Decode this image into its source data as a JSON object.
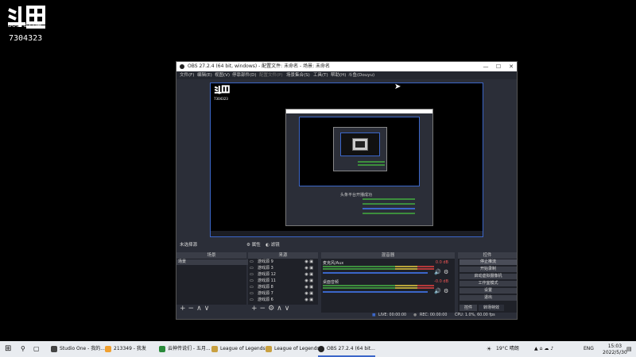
{
  "watermark": {
    "domain": "DOUYU.COM",
    "room_id": "7304323"
  },
  "obs": {
    "title": "OBS 27.2.4 (64 bit, windows) - 配置文件: 未命名 - 场景: 未命名",
    "window_controls": {
      "minimize": "—",
      "maximize": "☐",
      "close": "✕"
    },
    "menu": [
      "文件(F)",
      "编辑(E)",
      "视图(V)",
      "停靠部件(D)",
      "配置文件(P)",
      "场景集合(S)",
      "工具(T)",
      "帮助(H)",
      "斗鱼(Douyu)"
    ],
    "menu_disabled_index": 4,
    "preview_message": "头条平台开播成功",
    "scene_bar": {
      "label": "未选择源",
      "properties": "属性",
      "filters": "滤镜"
    },
    "docks": {
      "scenes": {
        "title": "场景",
        "items": [
          "场景"
        ]
      },
      "sources": {
        "title": "来源",
        "items": [
          "游戏源 9",
          "游戏源 3",
          "游戏源 12",
          "游戏源 11",
          "游戏源 8",
          "游戏源 7",
          "游戏源 6"
        ]
      },
      "mixer": {
        "title": "混音器",
        "tracks": [
          {
            "name": "麦克风/Aux",
            "level": "0.0 dB"
          },
          {
            "name": "桌面音频",
            "level": "-0.0 dB"
          }
        ]
      },
      "controls": {
        "title": "控件",
        "buttons": [
          "停止推流",
          "开始录制",
          "启动虚拟摄像机",
          "工作室模式",
          "设置",
          "退出"
        ],
        "tabs": [
          "控件",
          "转场特效"
        ]
      }
    },
    "status": {
      "live": "LIVE: 00:00:00",
      "rec": "REC: 00:00:00",
      "cpu": "CPU: 1.0%, 60.00 fps"
    }
  },
  "taskbar": {
    "apps": [
      "Studio One - 我的...",
      "213349 - 我发",
      "云神传说们 - 五月...",
      "League of Legends",
      "League of Legends...",
      "OBS 27.2.4 (64 bit..."
    ],
    "weather": "19°C 晴朗",
    "lang": "ENG",
    "time": "15:03",
    "date": "2022/5/30"
  },
  "colors": {
    "accent": "#3b66c9",
    "panel": "#2b2e38",
    "dock": "#1f2128"
  }
}
